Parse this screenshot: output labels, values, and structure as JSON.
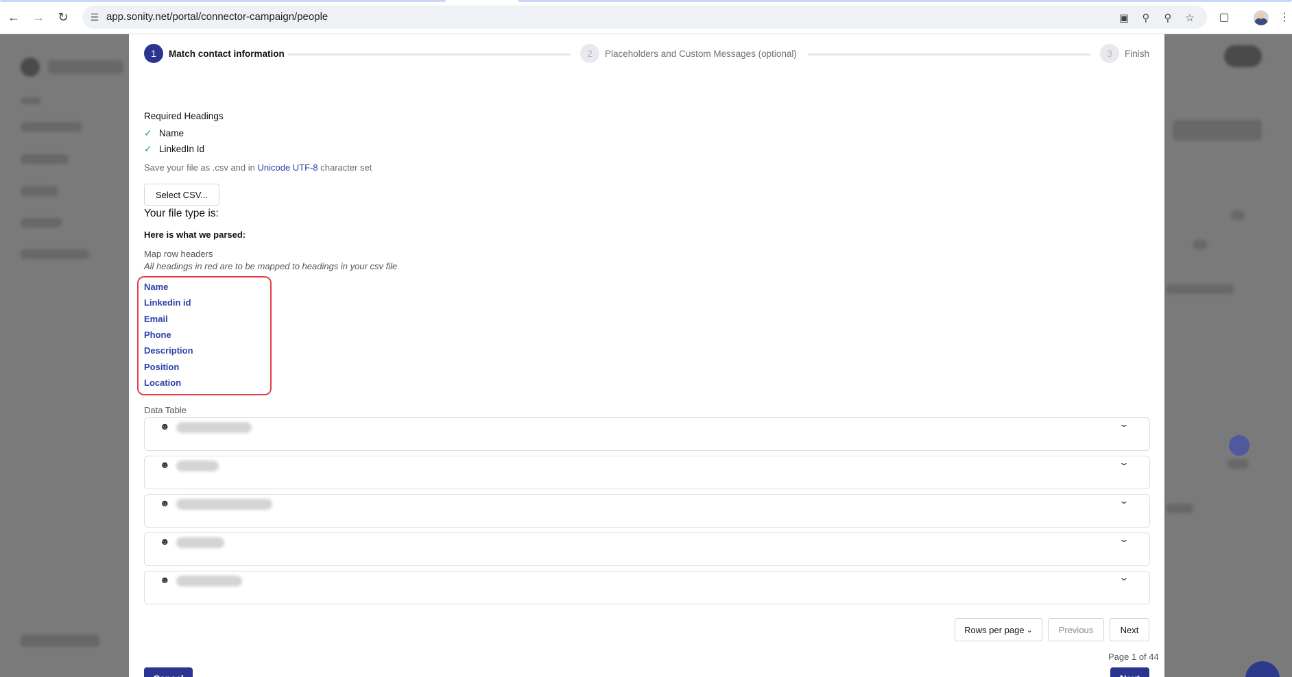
{
  "browser": {
    "url": "app.sonity.net/portal/connector-campaign/people"
  },
  "stepper": {
    "steps": [
      {
        "number": "1",
        "label": "Match contact information",
        "state": "active"
      },
      {
        "number": "2",
        "label": "Placeholders and Custom Messages (optional)",
        "state": "inactive"
      },
      {
        "number": "3",
        "label": "Finish",
        "state": "inactive"
      }
    ]
  },
  "required": {
    "title": "Required Headings",
    "items": [
      "Name",
      "LinkedIn Id"
    ]
  },
  "hint": {
    "prefix": "Save your file as .csv and in ",
    "link": "Unicode UTF-8",
    "suffix": " character set"
  },
  "upload": {
    "button_label": "Select CSV...",
    "file_type_label": "Your file type is:"
  },
  "parsed": {
    "title": "Here is what we parsed:",
    "map_title": "Map row headers",
    "map_subtitle": "All headings in red are to be mapped to headings in your csv file",
    "headers": [
      "Name",
      "Linkedin id",
      "Email",
      "Phone",
      "Description",
      "Position",
      "Location"
    ]
  },
  "table": {
    "title": "Data Table",
    "rows": [
      {
        "name": ""
      },
      {
        "name": ""
      },
      {
        "name": ""
      },
      {
        "name": ""
      },
      {
        "name": ""
      }
    ]
  },
  "pagination": {
    "rows_per_page_label": "Rows per page",
    "previous_label": "Previous",
    "next_label": "Next",
    "page_info": "Page 1 of 44"
  },
  "footer": {
    "cancel_label": "Cancel",
    "next_label": "Next"
  },
  "colors": {
    "primary": "#2a3590",
    "link": "#2b3fa8",
    "highlight_border": "#e0404a",
    "check": "#27a35a"
  }
}
